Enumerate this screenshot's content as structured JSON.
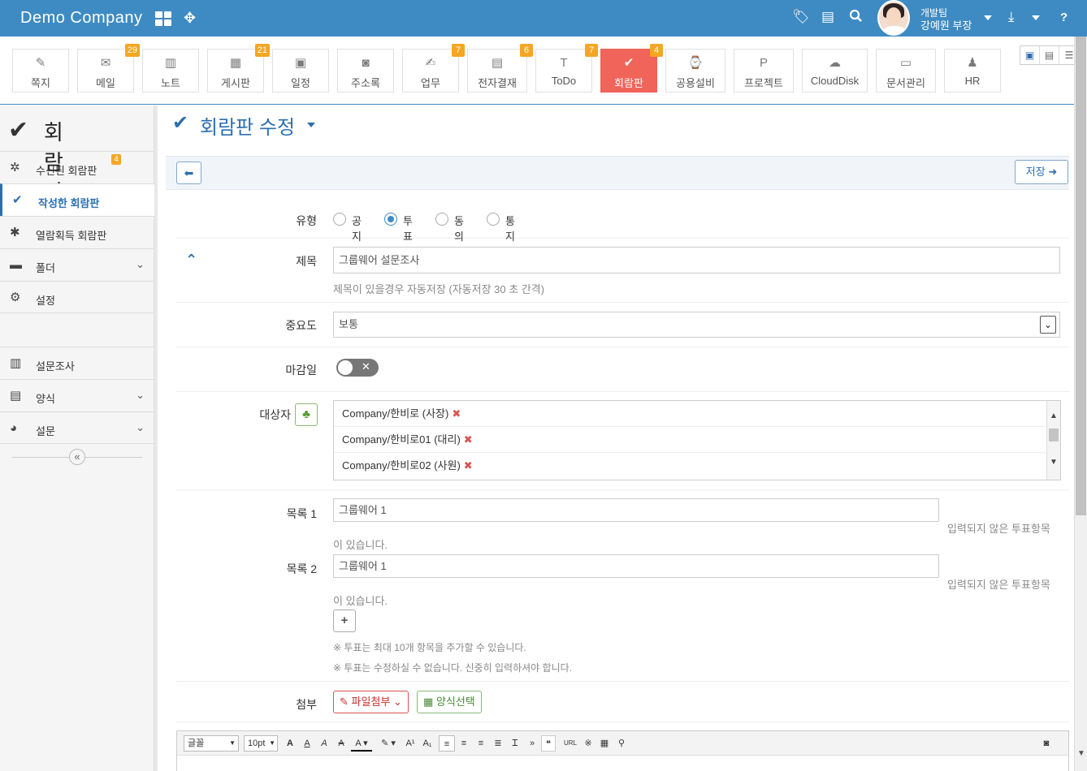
{
  "topbar": {
    "brand": "Demo Company",
    "user_team": "개발팀",
    "user_name": "강예원 부장",
    "help": "?"
  },
  "apps": [
    {
      "label": "쪽지",
      "icon": "memo-pin-icon",
      "badge": ""
    },
    {
      "label": "메일",
      "icon": "mail-icon",
      "badge": "29"
    },
    {
      "label": "노트",
      "icon": "note-icon",
      "badge": ""
    },
    {
      "label": "게시판",
      "icon": "board-icon",
      "badge": "21"
    },
    {
      "label": "일정",
      "icon": "calendar-icon",
      "badge": ""
    },
    {
      "label": "주소록",
      "icon": "address-book-icon",
      "badge": ""
    },
    {
      "label": "업무",
      "icon": "task-icon",
      "badge": "7"
    },
    {
      "label": "전자결재",
      "icon": "approval-icon",
      "badge": "6"
    },
    {
      "label": "ToDo",
      "icon": "todo-icon",
      "badge": "7"
    },
    {
      "label": "회람판",
      "icon": "circular-icon",
      "badge": "4"
    },
    {
      "label": "공용설비",
      "icon": "facility-icon",
      "badge": ""
    },
    {
      "label": "프로젝트",
      "icon": "project-icon",
      "badge": ""
    },
    {
      "label": "CloudDisk",
      "icon": "cloud-disk-icon",
      "badge": ""
    },
    {
      "label": "문서관리",
      "icon": "document-icon",
      "badge": ""
    },
    {
      "label": "HR",
      "icon": "hr-icon",
      "badge": ""
    }
  ],
  "sidebar": {
    "title": "회람판",
    "items": [
      {
        "label": "수신된 회람판",
        "badge": "4"
      },
      {
        "label": "작성한 회람판"
      },
      {
        "label": "열람획득 회람판"
      },
      {
        "label": "폴더"
      },
      {
        "label": "설정"
      },
      {
        "label": "설문조사"
      },
      {
        "label": "양식"
      },
      {
        "label": "설문"
      }
    ],
    "collapse_glyph": "«"
  },
  "main": {
    "title": "회람판 수정",
    "save_label": "저장",
    "type_label": "유형",
    "type_options": [
      "공지",
      "투표",
      "동의",
      "통지"
    ],
    "type_selected": "투표",
    "subject_label": "제목",
    "subject_value": "그룹웨어 설문조사",
    "subject_hint": "제목이 있을경우 자동저장 (자동저장 30 초 간격)",
    "priority_label": "중요도",
    "priority_value": "보통",
    "deadline_label": "마감일",
    "target_label": "대상자",
    "targets": [
      "Company/한비로 (사장)",
      "Company/한비로01 (대리)",
      "Company/한비로02 (사원)"
    ],
    "items": [
      {
        "label": "목록 1",
        "value": "그룹웨어 1",
        "warn_a": "입력되지 않은 투표항목",
        "warn_b": "이 있습니다."
      },
      {
        "label": "목록 2",
        "value": "그룹웨어 1",
        "warn_a": "입력되지 않은 투표항목",
        "warn_b": "이 있습니다."
      }
    ],
    "note1": "※ 투표는 최대 10개 항목을 추가할 수 있습니다.",
    "note2": "※ 투표는 수정하실 수 없습니다. 신중히 입력하셔야 합니다.",
    "attach_label": "첨부",
    "attach_file": "파일첨부",
    "attach_form": "양식선택"
  },
  "editor": {
    "font": "글꼴",
    "size": "10pt"
  },
  "colors": {
    "topbar": "#3e8bc3",
    "active_app": "#f0645a",
    "badge": "#f5a623",
    "accent": "#2c6fb1"
  }
}
